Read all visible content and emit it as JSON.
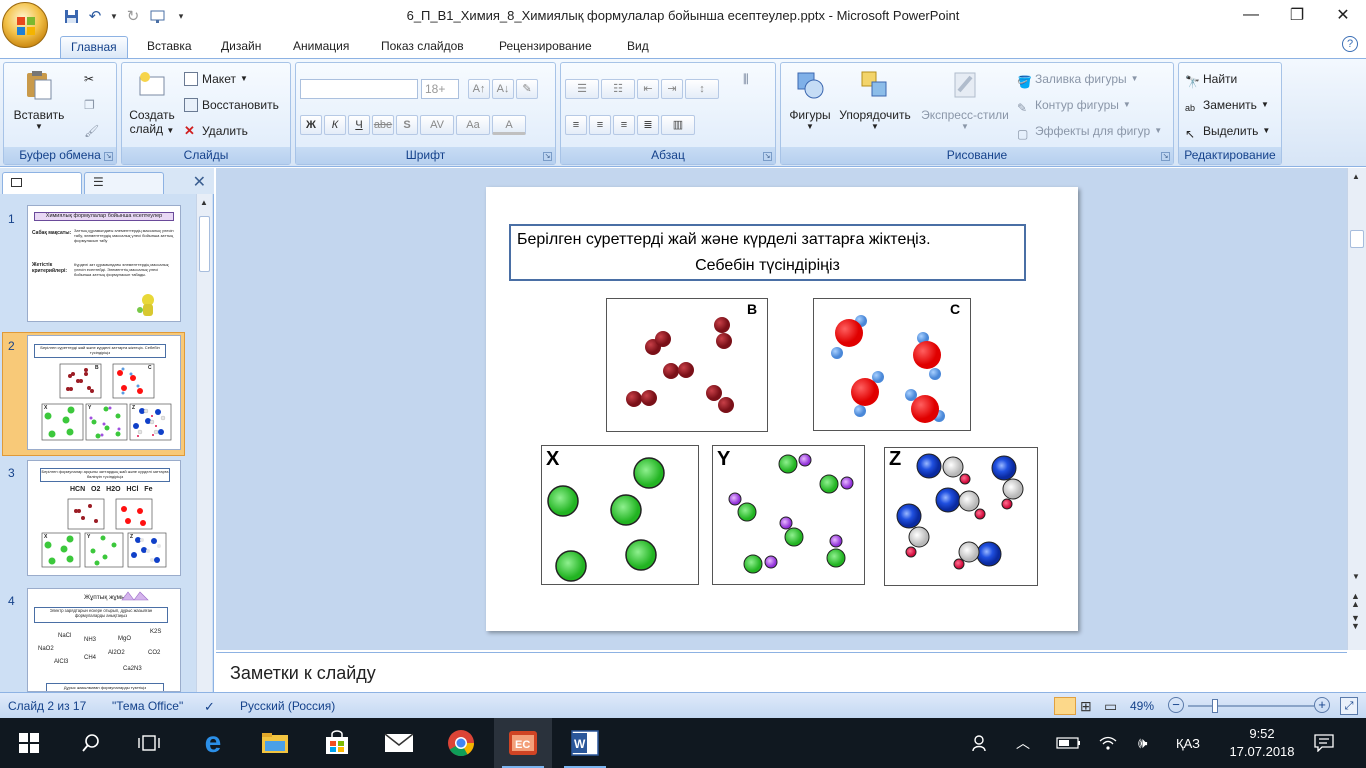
{
  "window": {
    "title": "6_П_В1_Химия_8_Химиялық формулалар бойынша есептеулер.pptx - Microsoft PowerPoint",
    "controls": [
      "minimize",
      "restore",
      "close"
    ]
  },
  "tabs": [
    "Главная",
    "Вставка",
    "Дизайн",
    "Анимация",
    "Показ слайдов",
    "Рецензирование",
    "Вид"
  ],
  "active_tab": "Главная",
  "ribbon": {
    "clipboard": {
      "title": "Буфер обмена",
      "paste": "Вставить"
    },
    "slides": {
      "title": "Слайды",
      "create_line1": "Создать",
      "create_line2": "слайд",
      "layout": "Макет",
      "reset": "Восстановить",
      "delete": "Удалить"
    },
    "font": {
      "title": "Шрифт",
      "size": "18+",
      "buttons": [
        "Ж",
        "К",
        "Ч",
        "abe",
        "S",
        "AV",
        "Aa",
        "A"
      ]
    },
    "paragraph": {
      "title": "Абзац"
    },
    "drawing": {
      "title": "Рисование",
      "shapes": "Фигуры",
      "arrange": "Упорядочить",
      "quick_styles": "Экспресс-стили",
      "fill": "Заливка фигуры",
      "outline": "Контур фигуры",
      "effects": "Эффекты для фигур"
    },
    "editing": {
      "title": "Редактирование",
      "find": "Найти",
      "replace": "Заменить",
      "select": "Выделить"
    }
  },
  "thumbnails": [
    {
      "num": "1",
      "title": "Химиялық формулалар бойынша есептеулер",
      "row1_label": "Сабақ мақсаты:",
      "row1_text": "Заттың құрамындағы элементтердің массалық үлесін табу, элементтердің массалық үлесі бойынша заттың формуласын табу",
      "row2_label": "Жетістік критерийлері:",
      "row2_text": "Күрделі зат құрамындағы элементтердің массалық үлесін есептейді. Элементтің массалық үлесі бойынша заттың формуласын табады."
    },
    {
      "num": "2",
      "title": "Берілген суреттерді жай және күрделі заттарға жіктеңіз. Себебін түсіндіріңіз",
      "selected": true
    },
    {
      "num": "3",
      "title": "Берілген формулалар арқылы заттардың жай және күрделі заттарға бөлінуін түсіндіріңіз",
      "formulas": "HCN   O2   H2O   HCl   Fe"
    },
    {
      "num": "4",
      "title": "Жұптық жұмыс",
      "subtitle": "Электр зарядтарын ескере отырып, дұрыс жазылған формулаларды анықтаңыз",
      "formulas": [
        "NaCl",
        "NH3",
        "MgO",
        "K2S",
        "NaO2",
        "Al2O2",
        "CO2",
        "AlCl3",
        "CH4",
        "Ca2N3"
      ],
      "footer": "Дұрыс жазылмаған формулаларды түзетіңіз"
    }
  ],
  "slide": {
    "question_line1": "Берілген суреттерді  жай және  күрделі заттарға жіктеңіз.",
    "question_line2": "Себебін түсіндіріңіз",
    "labels": {
      "B": "B",
      "C": "C",
      "X": "X",
      "Y": "Y",
      "Z": "Z"
    },
    "colors": {
      "dark_red": "#9b1c24",
      "red": "#ff1010",
      "light_blue": "#5b9be0",
      "green": "#3cc83c",
      "purple": "#a050e0",
      "royal_blue": "#1040c8",
      "gray_white": "#e6e6e6",
      "pink_red": "#e0104a"
    }
  },
  "notes_placeholder": "Заметки к слайду",
  "status": {
    "slide_counter": "Слайд 2 из 17",
    "theme": "\"Тема Office\"",
    "language": "Русский (Россия)",
    "zoom": "49%",
    "zoom_fraction": 0.49
  },
  "taskbar": {
    "time": "9:52",
    "date": "17.07.2018",
    "lang": "ҚАЗ"
  }
}
